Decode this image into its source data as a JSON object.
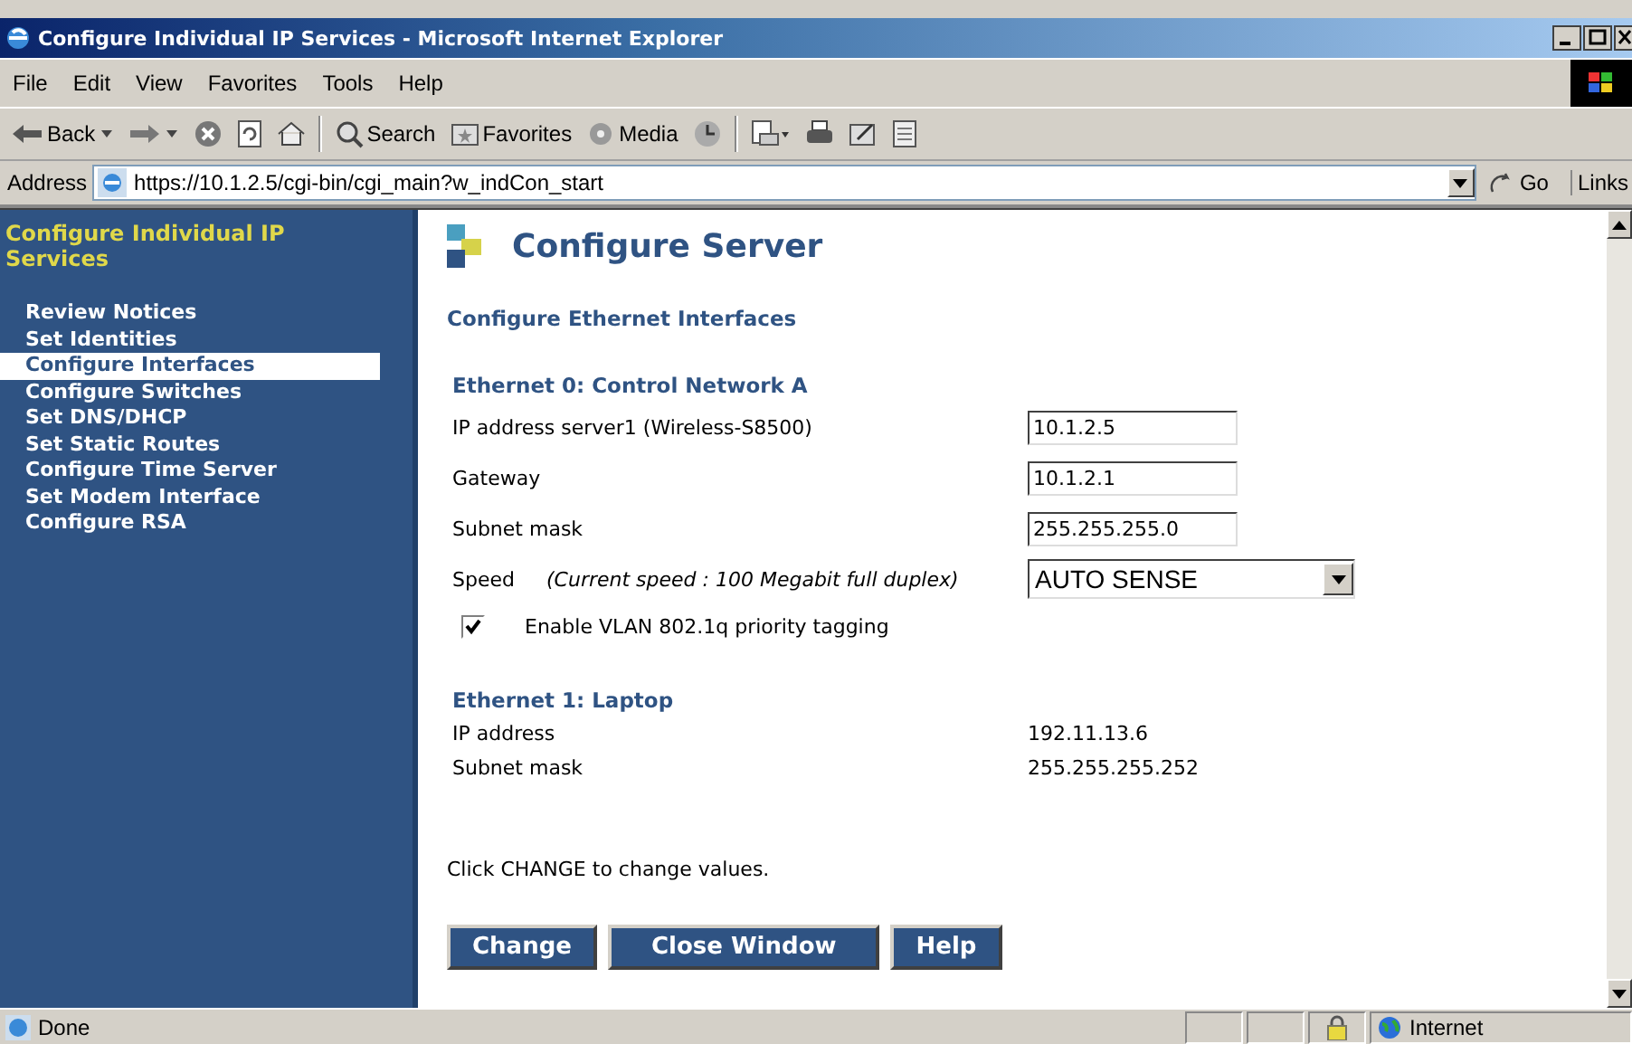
{
  "window": {
    "title": "Configure Individual IP Services - Microsoft Internet Explorer"
  },
  "menu": [
    "File",
    "Edit",
    "View",
    "Favorites",
    "Tools",
    "Help"
  ],
  "toolbar": [
    {
      "kind": "back",
      "label": "Back"
    },
    {
      "kind": "forward"
    },
    {
      "kind": "stop"
    },
    {
      "kind": "refresh"
    },
    {
      "kind": "home"
    },
    {
      "kind": "search",
      "label": "Search"
    },
    {
      "kind": "favorites",
      "label": "Favorites"
    },
    {
      "kind": "media",
      "label": "Media"
    },
    {
      "kind": "history"
    },
    {
      "kind": "mail"
    },
    {
      "kind": "print"
    },
    {
      "kind": "edit"
    },
    {
      "kind": "discuss"
    }
  ],
  "address": {
    "label": "Address",
    "url": "https://10.1.2.5/cgi-bin/cgi_main?w_indCon_start",
    "go": "Go",
    "links": "Links"
  },
  "sidebar": {
    "heading": "Configure Individual IP Services",
    "items": [
      {
        "label": "Review Notices",
        "selected": false
      },
      {
        "label": "Set Identities",
        "selected": false
      },
      {
        "label": "Configure Interfaces",
        "selected": true
      },
      {
        "label": "Configure Switches",
        "selected": false
      },
      {
        "label": "Set DNS/DHCP",
        "selected": false
      },
      {
        "label": "Set Static Routes",
        "selected": false
      },
      {
        "label": "Configure Time Server",
        "selected": false
      },
      {
        "label": "Set Modem Interface",
        "selected": false
      },
      {
        "label": "Configure RSA",
        "selected": false
      }
    ]
  },
  "page": {
    "title": "Configure Server",
    "section": "Configure Ethernet Interfaces",
    "ethernet0": {
      "heading": "Ethernet 0: Control Network A",
      "fields": [
        {
          "label": "IP address server1 (Wireless-S8500)",
          "value": "10.1.2.5"
        },
        {
          "label": "Gateway",
          "value": "10.1.2.1"
        },
        {
          "label": "Subnet mask",
          "value": "255.255.255.0"
        }
      ],
      "speed": {
        "label": "Speed",
        "note": "(Current speed : 100 Megabit full duplex)",
        "value": "AUTO SENSE"
      },
      "vlan": {
        "label": "Enable VLAN 802.1q priority tagging",
        "checked": true
      }
    },
    "ethernet1": {
      "heading": "Ethernet 1: Laptop",
      "rows": [
        {
          "label": "IP address",
          "value": "192.11.13.6"
        },
        {
          "label": "Subnet mask",
          "value": "255.255.255.252"
        }
      ]
    },
    "note": "Click CHANGE to change values.",
    "buttons": [
      "Change",
      "Close Window",
      "Help"
    ]
  },
  "status": {
    "text": "Done",
    "zone": "Internet"
  }
}
